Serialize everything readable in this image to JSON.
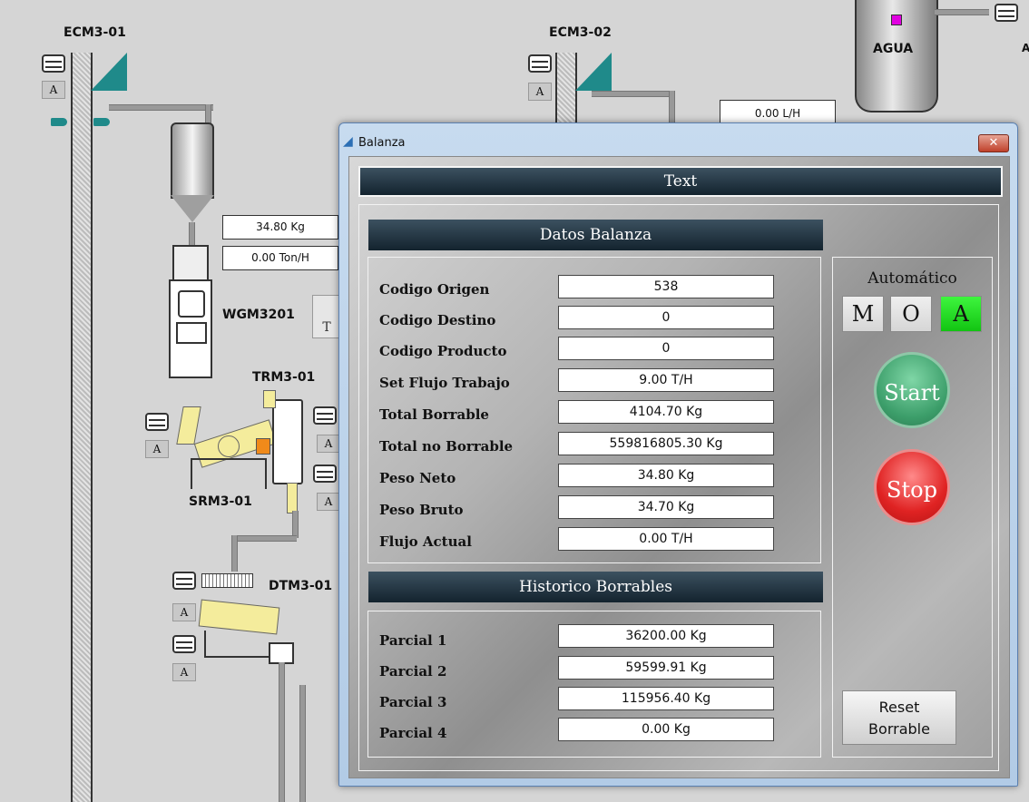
{
  "diagram": {
    "labels": {
      "ecm301": "ECM3-01",
      "ecm302": "ECM3-02",
      "agua": "AGUA",
      "wgm": "WGM3201",
      "trm": "TRM3-01",
      "srm": "SRM3-01",
      "dtm": "DTM3-01"
    },
    "a_label": "A",
    "peek_letter_t": "T",
    "readouts": {
      "flow_liters": "0.00 L/H",
      "weight": "34.80 Kg",
      "flow_tons": "0.00 Ton/H"
    }
  },
  "dialog": {
    "window_title": "Balanza",
    "close_symbol": "✕",
    "header_text": "Text",
    "datos_header": "Datos Balanza",
    "fields": [
      {
        "label": "Codigo Origen",
        "value": "538"
      },
      {
        "label": "Codigo Destino",
        "value": "0"
      },
      {
        "label": "Codigo Producto",
        "value": "0"
      },
      {
        "label": "Set Flujo Trabajo",
        "value": "9.00 T/H"
      },
      {
        "label": "Total Borrable",
        "value": "4104.70 Kg"
      },
      {
        "label": "Total no Borrable",
        "value": "559816805.30 Kg"
      },
      {
        "label": "Peso Neto",
        "value": "34.80 Kg"
      },
      {
        "label": "Peso Bruto",
        "value": "34.70 Kg"
      },
      {
        "label": "Flujo Actual",
        "value": "0.00 T/H"
      }
    ],
    "historico_header": "Historico Borrables",
    "parciales": [
      {
        "label": "Parcial 1",
        "value": "36200.00 Kg"
      },
      {
        "label": "Parcial 2",
        "value": "59599.91 Kg"
      },
      {
        "label": "Parcial 3",
        "value": "115956.40 Kg"
      },
      {
        "label": "Parcial 4",
        "value": "0.00 Kg"
      }
    ],
    "mode": {
      "title": "Automático",
      "manual": "M",
      "off": "O",
      "auto": "A",
      "active": "A"
    },
    "start_label": "Start",
    "stop_label": "Stop",
    "reset_line1": "Reset",
    "reset_line2": "Borrable"
  },
  "colors": {
    "active_green": "#22d822",
    "start_green": "#3f9f6e",
    "stop_red": "#d82020",
    "header_dark": "#1c2c38",
    "teal": "#1f8a8a"
  }
}
